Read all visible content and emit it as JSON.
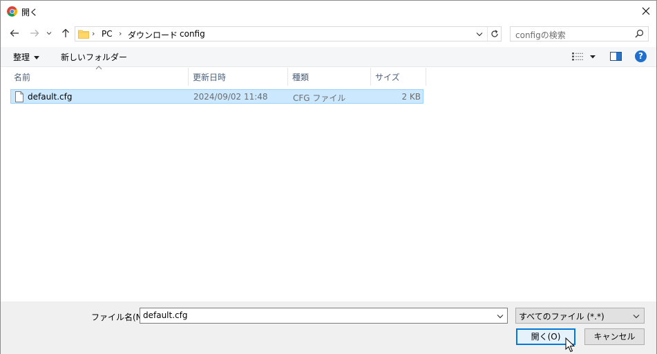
{
  "titlebar": {
    "title": "開く",
    "app_icon": "chrome-icon",
    "close_icon": "close-icon"
  },
  "navigation": {
    "back_icon": "arrow-left-icon",
    "forward_icon": "arrow-right-icon",
    "recent_icon": "chevron-down-icon",
    "up_icon": "arrow-up-icon",
    "breadcrumb": [
      "PC",
      "ダウンロード",
      "config"
    ],
    "search_placeholder": "configの検索"
  },
  "toolbar": {
    "organize_label": "整理",
    "new_folder_label": "新しいフォルダー"
  },
  "columns": [
    "名前",
    "更新日時",
    "種類",
    "サイズ"
  ],
  "files": [
    {
      "name": "default.cfg",
      "modified": "2024/09/02 11:48",
      "type": "CFG ファイル",
      "size": "2 KB",
      "selected": true
    }
  ],
  "footer": {
    "filename_label": "ファイル名(N):",
    "filename_value": "default.cfg",
    "filetype_value": "すべてのファイル (*.*)",
    "open_label": "開く(O)",
    "cancel_label": "キャンセル"
  },
  "colors": {
    "selection_bg": "#cce8ff",
    "selection_border": "#99d1ff",
    "accent": "#0078d7",
    "header_text": "#4c607a"
  }
}
